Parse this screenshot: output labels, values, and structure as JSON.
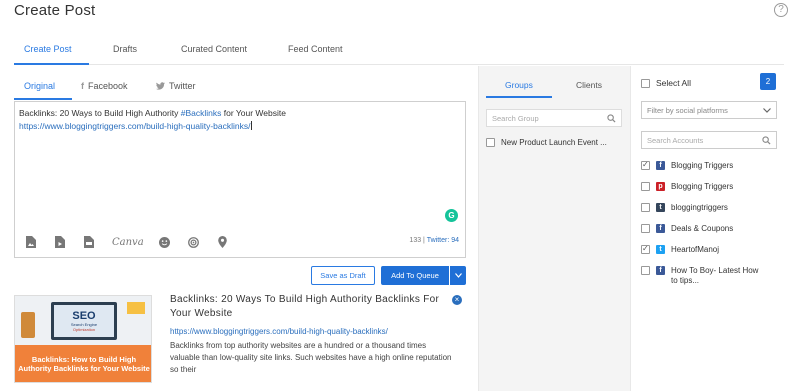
{
  "page": {
    "title": "Create Post",
    "help_icon": "?"
  },
  "top_tabs": [
    "Create Post",
    "Drafts",
    "Curated Content",
    "Feed Content"
  ],
  "sub_tabs": {
    "original": "Original",
    "facebook": "Facebook",
    "twitter": "Twitter",
    "facebook_icon": "f"
  },
  "editor": {
    "line1_prefix": "Backlinks: 20 Ways to Build High Authority ",
    "hashtag": "#Backlinks",
    "line1_suffix": " for Your Website",
    "url": "https://www.bloggingtriggers.com/build-high-quality-backlinks/",
    "grammarly": "G",
    "canva": "Canva",
    "char_count": "133",
    "twitter_count": "Twitter: 94",
    "count_sep": " | "
  },
  "actions": {
    "save_draft": "Save as Draft",
    "add_to_queue": "Add To Queue"
  },
  "preview": {
    "title": "Backlinks: 20 Ways To Build High Authority Backlinks For Your Website",
    "url": "https://www.bloggingtriggers.com/build-high-quality-backlinks/",
    "description": "Backlinks from top authority websites are a hundred or a thousand times valuable than low-quality site links. Such websites have a high online reputation so their",
    "thumb_seo": "SEO",
    "thumb_sub": "Search Engine",
    "thumb_sub2": "Optimization",
    "thumb_banner": "Backlinks: How to Build High Authority Backlinks for Your Website"
  },
  "groups_panel": {
    "tabs": [
      "Groups",
      "Clients"
    ],
    "search_placeholder": "Search Group",
    "items": [
      {
        "label": "New Product Launch Event ...",
        "checked": false
      }
    ]
  },
  "accounts_panel": {
    "select_all": "Select All",
    "selected_count": "2",
    "filter_placeholder": "Filter by social platforms",
    "search_placeholder": "Search Accounts",
    "accounts": [
      {
        "name": "Blogging Triggers",
        "platform": "facebook",
        "checked": true
      },
      {
        "name": "Blogging Triggers",
        "platform": "pinterest",
        "checked": false
      },
      {
        "name": "bloggingtriggers",
        "platform": "tumblr",
        "checked": false
      },
      {
        "name": "Deals & Coupons",
        "platform": "facebook",
        "checked": false
      },
      {
        "name": "HeartofManoj",
        "platform": "twitter",
        "checked": true
      },
      {
        "name": "How To Boy- Latest How to tips...",
        "platform": "facebook",
        "checked": false
      }
    ]
  },
  "colors": {
    "accent": "#2a7ae2",
    "button_primary": "#1f6fd6",
    "link": "#2a6ebd",
    "panel_bg": "#f4f4f4"
  }
}
